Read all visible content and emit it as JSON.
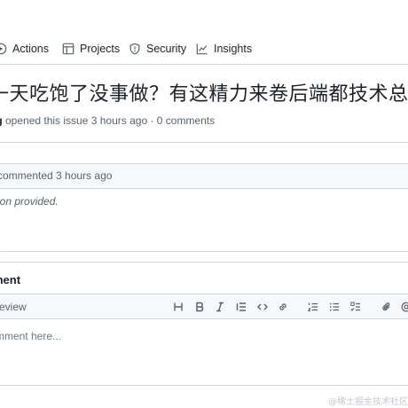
{
  "tabs": [
    {
      "label": "Actions",
      "icon": "play-icon"
    },
    {
      "label": "Projects",
      "icon": "table-icon"
    },
    {
      "label": "Security",
      "icon": "shield-icon"
    },
    {
      "label": "Insights",
      "icon": "graph-icon"
    }
  ],
  "issue": {
    "title": "一天吃饱了没事做？有这精力来卷后端都技术总",
    "author_fragment": "ng",
    "meta_text": " opened this issue 3 hours ago · 0 comments"
  },
  "comment": {
    "header_text": "commented 3 hours ago",
    "body_text": "ion provided."
  },
  "add_comment": {
    "heading": "ment",
    "preview_tab": "review",
    "placeholder": "mment here...",
    "toolbar_icons": [
      "heading-icon",
      "bold-icon",
      "italic-icon",
      "quote-icon",
      "code-icon",
      "link-icon",
      "ordered-list-icon",
      "unordered-list-icon",
      "task-list-icon",
      "attach-icon",
      "mention-icon"
    ]
  },
  "watermark": "@稀土掘金技术社区",
  "colors": {
    "border": "#d0d7de",
    "header_bg": "#f6f8fa",
    "text": "#1f2328",
    "muted": "#59636e"
  }
}
